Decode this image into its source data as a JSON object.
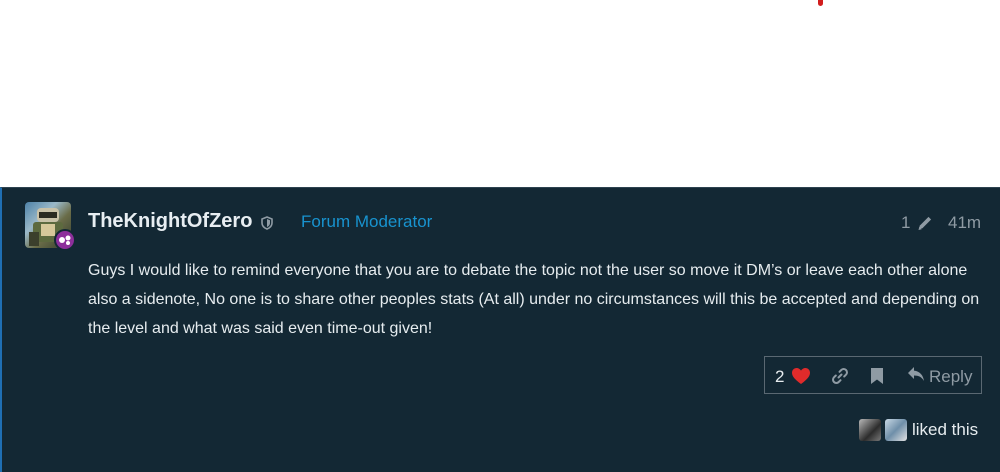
{
  "post": {
    "username": "TheKnightOfZero",
    "role": "Forum Moderator",
    "edit_count": "1",
    "time": "41m",
    "body": "Guys I would like to remind everyone that you are to debate the topic not the user so move it DM’s or leave each other alone also a sidenote, No one is to share other peoples stats (At all) under no circumstances will this be accepted and depending on the level and what was said even time-out given!",
    "like_count": "2",
    "reply_label": "Reply",
    "liked_text": "liked this"
  },
  "icons": [
    "shield-icon",
    "pencil-icon",
    "heart-icon",
    "link-icon",
    "bookmark-icon",
    "reply-icon",
    "flair-icon"
  ],
  "colors": {
    "post_bg": "#132834",
    "role": "#1893cf",
    "muted": "#8f9ba4",
    "heart": "#e02b2b",
    "flair": "#8d2f9b"
  }
}
